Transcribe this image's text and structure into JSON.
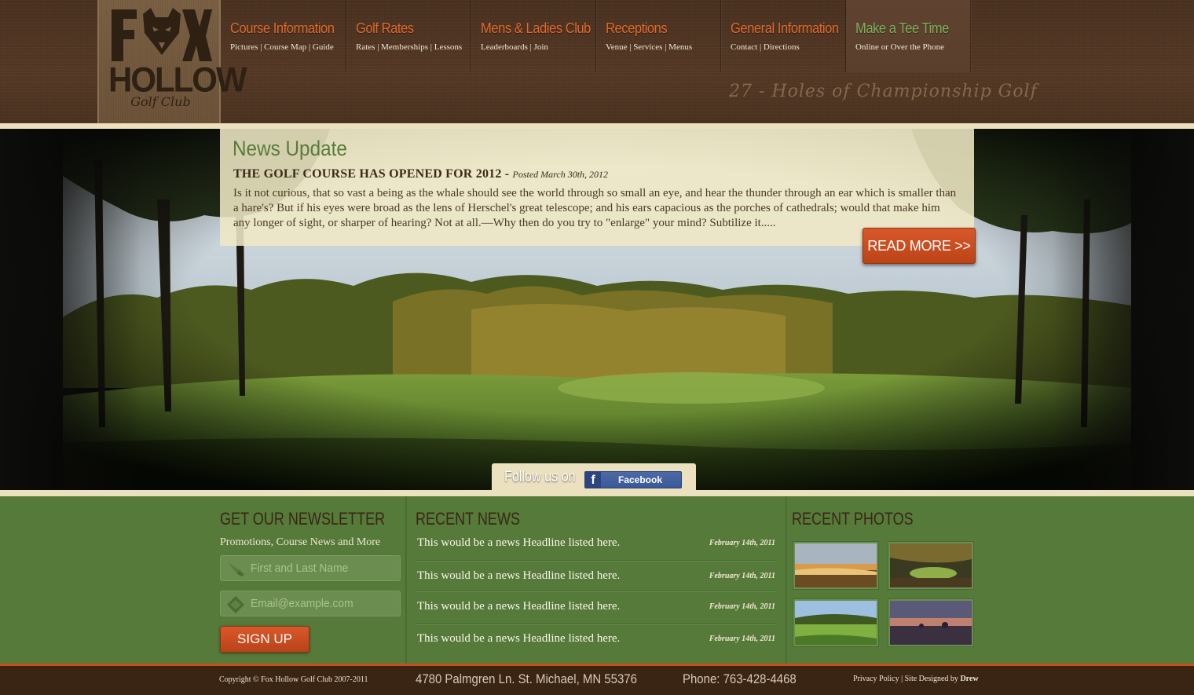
{
  "logo": {
    "name_top": "FOX",
    "name_main": "HOLLOW",
    "name_sub": "Golf Club"
  },
  "nav": [
    {
      "title": "Course Information",
      "sub": "Pictures | Course Map | Guide"
    },
    {
      "title": "Golf Rates",
      "sub": "Rates | Memberships | Lessons"
    },
    {
      "title": "Mens & Ladies Club",
      "sub": "Leaderboards | Join"
    },
    {
      "title": "Receptions",
      "sub": "Venue | Services | Menus"
    },
    {
      "title": "General Information",
      "sub": "Contact | Directions"
    },
    {
      "title": "Make a Tee Time",
      "sub": "Online or Over the Phone"
    }
  ],
  "tagline": "27 - Holes of Championship Golf",
  "news_update": {
    "title": "News Update",
    "headline": "THE GOLF COURSE HAS OPENED FOR 2012 - ",
    "posted": "Posted March 30th, 2012",
    "body": "Is it not curious, that so vast a being as the whale should see the world through so small an eye, and hear the thunder through an ear which is smaller than a hare's? But if his eyes were broad as the lens of Herschel's great telescope; and his ears capacious as the porches of cathedrals; would that make him any longer of sight, or sharper of hearing? Not at all.—Why then do you try to \"enlarge\" your mind? Subtilize it.....",
    "read_more": "READ MORE  >>"
  },
  "follow": {
    "text": "Follow us on",
    "facebook": "Facebook",
    "facebook_f": "f"
  },
  "newsletter": {
    "title": "GET OUR NEWSLETTER",
    "subtitle": "Promotions, Course News and More",
    "name_placeholder": "First and Last Name",
    "email_placeholder": "Email@example.com",
    "signup": "SIGN UP"
  },
  "recent_news": {
    "title": "RECENT NEWS",
    "items": [
      {
        "headline": "This would be a news Headline listed here.",
        "date": "February 14th, 2011"
      },
      {
        "headline": "This would be a news Headline listed here.",
        "date": "February 14th, 2011"
      },
      {
        "headline": "This would be a news Headline listed here.",
        "date": "February 14th, 2011"
      },
      {
        "headline": "This would be a news Headline listed here.",
        "date": "February 14th, 2011"
      }
    ]
  },
  "recent_photos": {
    "title": "RECENT PHOTOS"
  },
  "footer": {
    "copyright": "Copyright © Fox Hollow Golf Club 2007-2011",
    "address": "4780 Palmgren Ln.  St. Michael, MN  55376",
    "phone": "Phone: 763-428-4468",
    "links": "Privacy Policy | Site Designed by ",
    "designer": "Drew"
  },
  "colors": {
    "header_brown": "#553925",
    "accent_orange": "#e06a2c",
    "active_green": "#7fb15a",
    "band_green": "#557a3a",
    "cream": "#ece1bf",
    "footer_brown": "#3a2414"
  }
}
